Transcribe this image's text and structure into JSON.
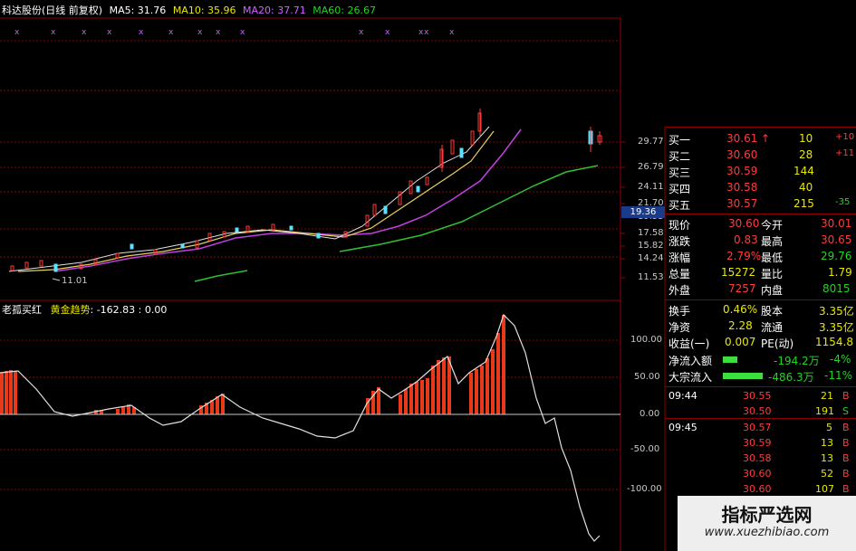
{
  "header": {
    "title": "科达股份(日线 前复权)",
    "ma5": "MA5: 31.76",
    "ma10": "MA10: 35.96",
    "ma20": "MA20: 37.71",
    "ma60": "MA60: 26.67"
  },
  "price_axis": {
    "labels": [
      "29.77",
      "26.79",
      "24.11",
      "21.70",
      "19.53",
      "17.58",
      "15.82",
      "14.24",
      "11.53"
    ],
    "current_price_tag": "19.36",
    "low_annotation": "11.01"
  },
  "indicator": {
    "title": "老孤买红",
    "name": "黄金趋势",
    "value": ": -162.83 : 0.00",
    "axis_labels": [
      "100.00",
      "50.00",
      "0.00",
      "-50.00",
      "-100.00"
    ]
  },
  "quote": {
    "bids": [
      {
        "label": "买一",
        "price": "30.61",
        "arrow": "↑",
        "vol": "10",
        "chg": "+10"
      },
      {
        "label": "买二",
        "price": "30.60",
        "arrow": "",
        "vol": "28",
        "chg": "+11"
      },
      {
        "label": "买三",
        "price": "30.59",
        "arrow": "",
        "vol": "144",
        "chg": ""
      },
      {
        "label": "买四",
        "price": "30.58",
        "arrow": "",
        "vol": "40",
        "chg": ""
      },
      {
        "label": "买五",
        "price": "30.57",
        "arrow": "",
        "vol": "215",
        "chg": "-35"
      }
    ],
    "stats": [
      {
        "l1": "现价",
        "v1": "30.60",
        "l2": "今开",
        "v2": "30.01"
      },
      {
        "l1": "涨跌",
        "v1": "0.83",
        "l2": "最高",
        "v2": "30.65"
      },
      {
        "l1": "涨幅",
        "v1": "2.79%",
        "l2": "最低",
        "v2": "29.76"
      },
      {
        "l1": "总量",
        "v1": "15272",
        "l2": "量比",
        "v2": "1.79"
      },
      {
        "l1": "外盘",
        "v1": "7257",
        "l2": "内盘",
        "v2": "8015"
      }
    ],
    "fund": [
      {
        "l1": "换手",
        "v1": "0.46%",
        "l2": "股本",
        "v2": "3.35亿"
      },
      {
        "l1": "净资",
        "v1": "2.28",
        "l2": "流通",
        "v2": "3.35亿"
      },
      {
        "l1": "收益(一)",
        "v1": "0.007",
        "l2": "PE(动)",
        "v2": "1154.8"
      }
    ],
    "flow": [
      {
        "label": "净流入额",
        "value": "-194.2万",
        "pct": "-4%"
      },
      {
        "label": "大宗流入",
        "value": "-486.3万",
        "pct": "-11%"
      }
    ],
    "trades": [
      {
        "time": "09:44",
        "price": "30.55",
        "vol": "21",
        "side": "B"
      },
      {
        "time": "",
        "price": "30.50",
        "vol": "191",
        "side": "S"
      },
      {
        "time": "09:45",
        "price": "30.57",
        "vol": "5",
        "side": "B"
      },
      {
        "time": "",
        "price": "30.59",
        "vol": "13",
        "side": "B"
      },
      {
        "time": "",
        "price": "30.58",
        "vol": "13",
        "side": "B"
      },
      {
        "time": "",
        "price": "30.60",
        "vol": "52",
        "side": "B"
      },
      {
        "time": "",
        "price": "30.60",
        "vol": "107",
        "side": "B"
      }
    ]
  },
  "watermark": {
    "title": "指标严选网",
    "url": "www.xuezhibiao.com"
  },
  "colors": {
    "up": "#ff3b3b",
    "down": "#22d422",
    "grid": "#8b0000",
    "ma5": "#e0e0e0",
    "ma10": "#e8d060",
    "ma20": "#c040e0",
    "ma60": "#30c030"
  }
}
